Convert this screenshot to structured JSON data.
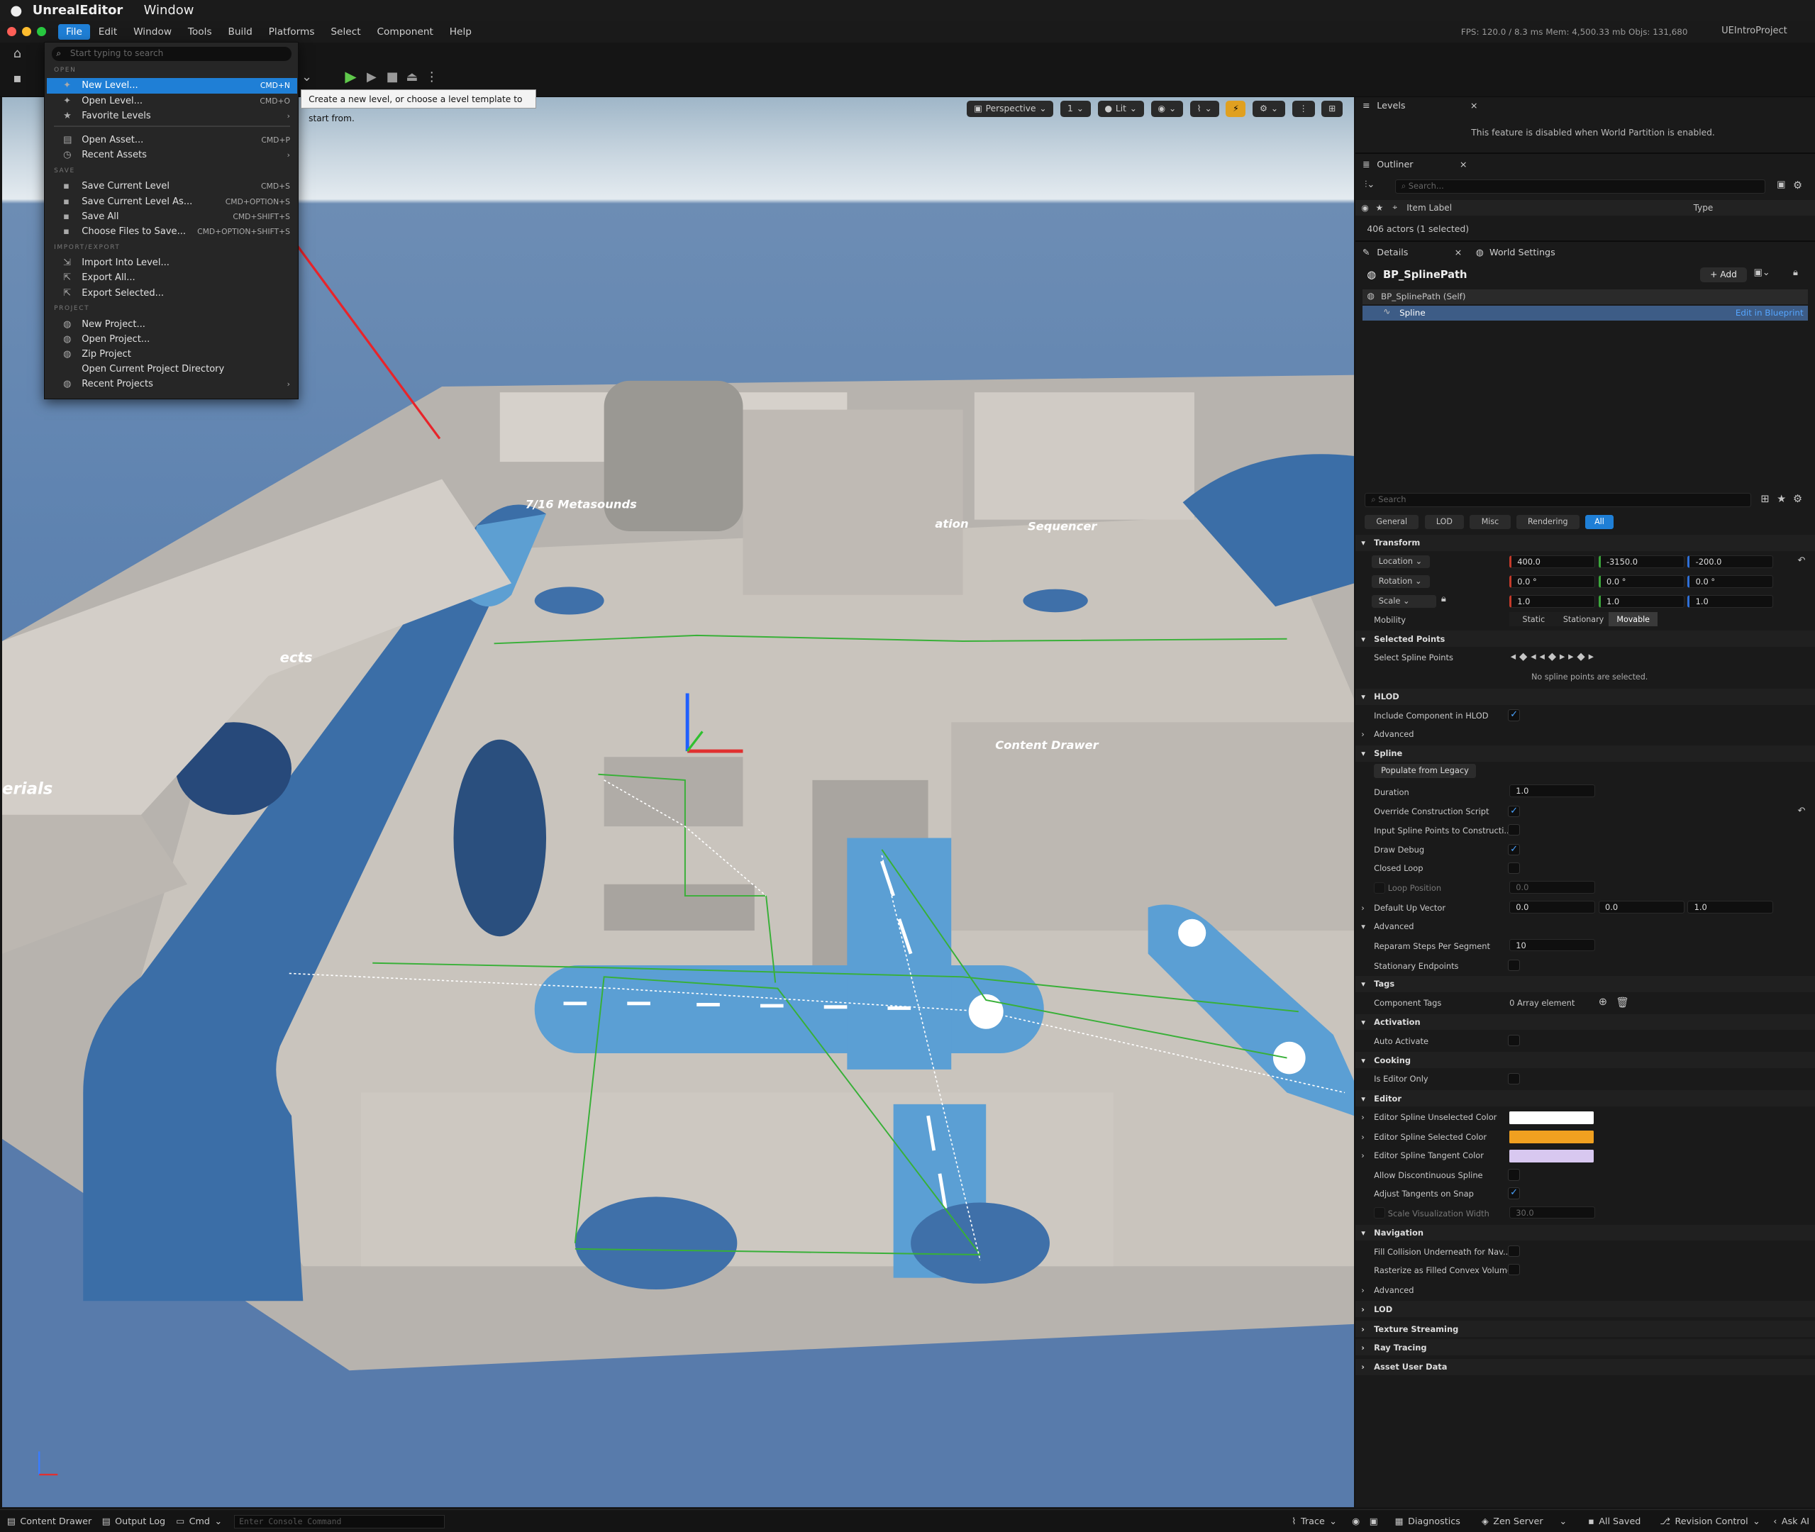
{
  "mac": {
    "app_name": "UnrealEditor",
    "window_menu": "Window"
  },
  "menubar": {
    "items": [
      "File",
      "Edit",
      "Window",
      "Tools",
      "Build",
      "Platforms",
      "Select",
      "Component",
      "Help"
    ],
    "stats": "FPS: 120.0  / 8.3 ms  Mem: 4,500.33 mb  Objs: 131,680",
    "project": "UEIntroProject"
  },
  "file_menu": {
    "search_placeholder": "Start typing to search",
    "sections": {
      "open": "OPEN",
      "save": "SAVE",
      "import_export": "IMPORT/EXPORT",
      "project": "PROJECT"
    },
    "items": [
      {
        "label": "New Level...",
        "shortcut": "CMD+N"
      },
      {
        "label": "Open Level...",
        "shortcut": "CMD+O"
      },
      {
        "label": "Favorite Levels",
        "shortcut": ""
      },
      {
        "label": "Open Asset...",
        "shortcut": "CMD+P"
      },
      {
        "label": "Recent Assets",
        "shortcut": ""
      },
      {
        "label": "Save Current Level",
        "shortcut": "CMD+S"
      },
      {
        "label": "Save Current Level As...",
        "shortcut": "CMD+OPTION+S"
      },
      {
        "label": "Save All",
        "shortcut": "CMD+SHIFT+S"
      },
      {
        "label": "Choose Files to Save...",
        "shortcut": "CMD+OPTION+SHIFT+S"
      },
      {
        "label": "Import Into Level...",
        "shortcut": ""
      },
      {
        "label": "Export All...",
        "shortcut": ""
      },
      {
        "label": "Export Selected...",
        "shortcut": ""
      },
      {
        "label": "New Project...",
        "shortcut": ""
      },
      {
        "label": "Open Project...",
        "shortcut": ""
      },
      {
        "label": "Zip Project",
        "shortcut": ""
      },
      {
        "label": "Open Current Project Directory",
        "shortcut": ""
      },
      {
        "label": "Recent Projects",
        "shortcut": ""
      }
    ]
  },
  "tooltip": "Create a new level, or choose a level template to start from.",
  "viewport": {
    "perspective": "Perspective",
    "fov_count": "1",
    "lit": "Lit",
    "scene_labels": [
      "7/16 Metasounds",
      "Sequencer",
      "Content Drawer",
      "erials",
      "ects",
      "ation"
    ]
  },
  "levels": {
    "tab": "Levels",
    "message": "This feature is disabled when World Partition is enabled."
  },
  "outliner": {
    "tab": "Outliner",
    "search_placeholder": "Search...",
    "col_label": "Item Label",
    "col_type": "Type",
    "count": "406 actors (1 selected)"
  },
  "details": {
    "tab": "Details",
    "tab2": "World Settings",
    "actor": "BP_SplinePath",
    "add": "+ Add",
    "self": "BP_SplinePath (Self)",
    "component": "Spline",
    "edit_link": "Edit in Blueprint",
    "search_placeholder": "Search",
    "filters": [
      "General",
      "LOD",
      "Misc",
      "Rendering",
      "All"
    ],
    "transform": {
      "title": "Transform",
      "location_label": "Location",
      "location": [
        "400.0",
        "-3150.0",
        "-200.0"
      ],
      "rotation_label": "Rotation",
      "rotation": [
        "0.0 °",
        "0.0 °",
        "0.0 °"
      ],
      "scale_label": "Scale",
      "scale": [
        "1.0",
        "1.0",
        "1.0"
      ],
      "mobility_label": "Mobility",
      "mobility": [
        "Static",
        "Stationary",
        "Movable"
      ]
    },
    "selected_points": {
      "title": "Selected Points",
      "label": "Select Spline Points",
      "message": "No spline points are selected."
    },
    "hlod": {
      "title": "HLOD",
      "include": "Include Component in HLOD",
      "advanced": "Advanced"
    },
    "spline": {
      "title": "Spline",
      "populate": "Populate from Legacy",
      "duration": "Duration",
      "duration_value": "1.0",
      "override": "Override Construction Script",
      "input_points": "Input Spline Points to Constructi...",
      "draw_debug": "Draw Debug",
      "closed_loop": "Closed Loop",
      "loop_position": "Loop Position",
      "loop_position_value": "0.0",
      "default_up": "Default Up Vector",
      "default_up_value": [
        "0.0",
        "0.0",
        "1.0"
      ],
      "advanced": "Advanced",
      "reparam": "Reparam Steps Per Segment",
      "reparam_value": "10",
      "stationary": "Stationary Endpoints"
    },
    "tags": {
      "title": "Tags",
      "component_tags": "Component Tags",
      "value": "0 Array element"
    },
    "activation": {
      "title": "Activation",
      "auto": "Auto Activate"
    },
    "cooking": {
      "title": "Cooking",
      "editor_only": "Is Editor Only"
    },
    "editor": {
      "title": "Editor",
      "unselected": "Editor Spline Unselected Color",
      "unselected_color": "#ffffff",
      "selected": "Editor Spline Selected Color",
      "selected_color": "#f0a020",
      "tangent": "Editor Spline Tangent Color",
      "tangent_color": "#d8c8f0",
      "discontinuous": "Allow Discontinuous Spline",
      "adjust": "Adjust Tangents on Snap",
      "scale_width": "Scale Visualization Width",
      "scale_width_value": "30.0"
    },
    "navigation": {
      "title": "Navigation",
      "fill": "Fill Collision Underneath for Nav...",
      "rasterize": "Rasterize as Filled Convex Volume",
      "advanced": "Advanced"
    },
    "collapsed": [
      "LOD",
      "Texture Streaming",
      "Ray Tracing",
      "Asset User Data"
    ]
  },
  "statusbar": {
    "content_drawer": "Content Drawer",
    "output_log": "Output Log",
    "cmd": "Cmd",
    "console_placeholder": "Enter Console Command",
    "trace": "Trace",
    "diagnostics": "Diagnostics",
    "zen": "Zen Server",
    "saved": "All Saved",
    "revision": "Revision Control",
    "ask_ai": "Ask AI"
  },
  "colors": {
    "accent": "#1f7fd6",
    "viewport_floor": "#4b73a8",
    "wall": "#c9c4bd",
    "spline": "#3aa53a"
  }
}
